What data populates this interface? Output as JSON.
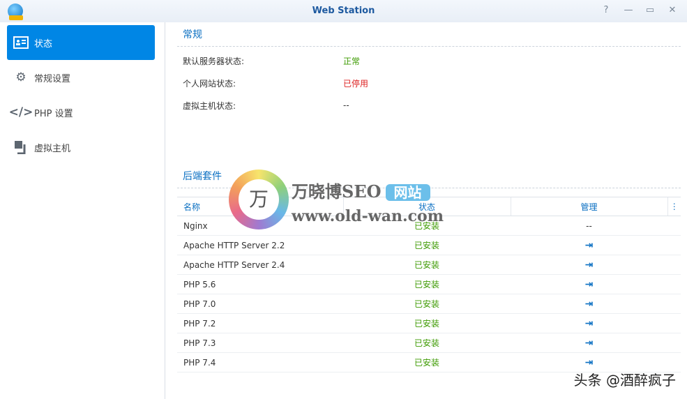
{
  "window": {
    "title": "Web Station",
    "help": "?",
    "minimize": "—",
    "maximize": "▭",
    "close": "✕"
  },
  "sidebar": {
    "items": [
      {
        "label": "状态"
      },
      {
        "label": "常规设置"
      },
      {
        "label": "PHP 设置"
      },
      {
        "label": "虚拟主机"
      }
    ]
  },
  "general": {
    "title": "常规",
    "rows": [
      {
        "label": "默认服务器状态:",
        "value": "正常"
      },
      {
        "label": "个人网站状态:",
        "value": "已停用"
      },
      {
        "label": "虚拟主机状态:",
        "value": "--"
      }
    ]
  },
  "backend": {
    "title": "后端套件",
    "columns": [
      "名称",
      "状态",
      "管理"
    ],
    "rows": [
      {
        "name": "Nginx",
        "status": "已安装",
        "manage": "--"
      },
      {
        "name": "Apache HTTP Server 2.2",
        "status": "已安装",
        "manage": "⇥"
      },
      {
        "name": "Apache HTTP Server 2.4",
        "status": "已安装",
        "manage": "⇥"
      },
      {
        "name": "PHP 5.6",
        "status": "已安装",
        "manage": "⇥"
      },
      {
        "name": "PHP 7.0",
        "status": "已安装",
        "manage": "⇥"
      },
      {
        "name": "PHP 7.2",
        "status": "已安装",
        "manage": "⇥"
      },
      {
        "name": "PHP 7.3",
        "status": "已安装",
        "manage": "⇥"
      },
      {
        "name": "PHP 7.4",
        "status": "已安装",
        "manage": "⇥"
      }
    ]
  },
  "watermark": {
    "logo_char": "万",
    "name": "万晓博SEO",
    "badge": "网站",
    "url": "www.old-wan.com",
    "credit": "头条 @酒醉疯子"
  }
}
